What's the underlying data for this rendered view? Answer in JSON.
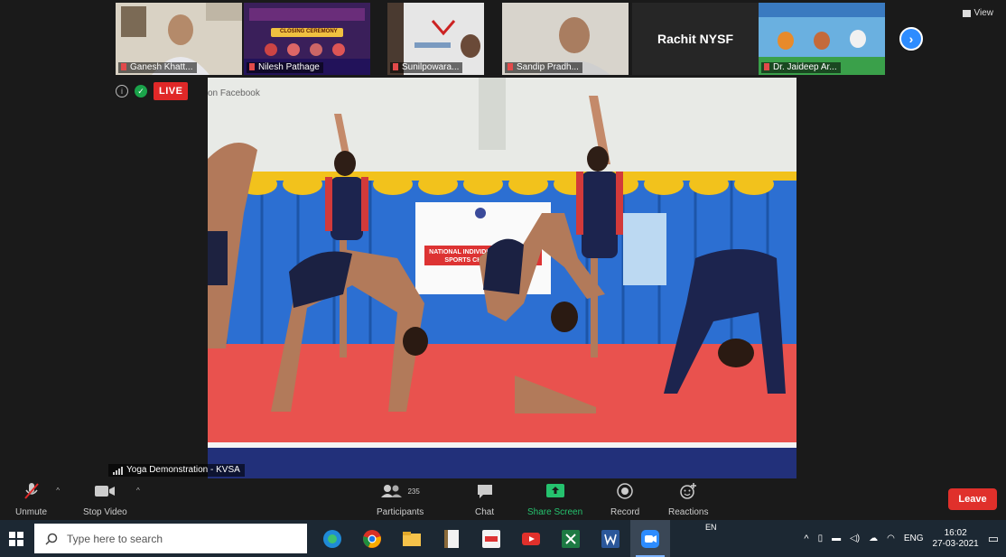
{
  "thumbnails": [
    {
      "name": "Ganesh Khatt..."
    },
    {
      "name": "Nilesh Pathage",
      "slide_title": "CLOSING CEREMONY"
    },
    {
      "name": "Sunilpowara..."
    },
    {
      "name": "Sandip Pradh..."
    },
    {
      "name": "",
      "big_text": "Rachit NYSF"
    },
    {
      "name": "Dr. Jaideep Ar..."
    }
  ],
  "view_button": {
    "label": "View"
  },
  "status": {
    "live": "LIVE",
    "stream_dest": "on Facebook"
  },
  "video": {
    "banner_line1": "NATIONAL INDIVIDUAL YOGASANA",
    "banner_line2": "SPORTS CHAMPIONSHIP",
    "speaker": "Yoga Demonstration - KVSA"
  },
  "toolbar": {
    "unmute": "Unmute",
    "stop_video": "Stop Video",
    "participants": "Participants",
    "participants_count": "235",
    "chat": "Chat",
    "share_screen": "Share Screen",
    "record": "Record",
    "reactions": "Reactions",
    "leave": "Leave"
  },
  "taskbar": {
    "search_placeholder": "Type here to search",
    "lang_top": "EN",
    "lang": "ENG",
    "time": "16:02",
    "date": "27-03-2021"
  },
  "colors": {
    "accent": "#2d8cff",
    "live": "#e02828",
    "share": "#25c26e",
    "leave": "#e0302b"
  }
}
